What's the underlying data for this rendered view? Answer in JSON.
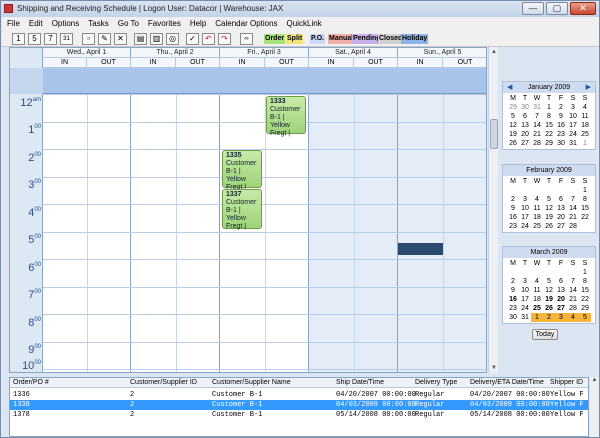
{
  "window": {
    "title": "Shipping and Receiving Schedule | Logon User: Datacor | Warehouse: JAX",
    "min": "—",
    "max": "▢",
    "close": "✕"
  },
  "menu": [
    "File",
    "Edit",
    "Options",
    "Tasks",
    "Go To",
    "Favorites",
    "Help",
    "Calendar Options",
    "QuickLink"
  ],
  "toolbar": {
    "buttons": [
      "1",
      "5",
      "7",
      "31",
      "new",
      "edit",
      "delete",
      "print",
      "preview",
      "find",
      "check",
      "undo",
      "redo",
      "link"
    ],
    "legend": [
      {
        "label": "Order",
        "color": "#a8e27a"
      },
      {
        "label": "Split",
        "color": "#f4e27a"
      },
      {
        "label": "P.O.",
        "color": "#c9d8f4"
      },
      {
        "label": "Manual",
        "color": "#f0b0a8"
      },
      {
        "label": "Pending",
        "color": "#c8b0e8"
      },
      {
        "label": "Closed",
        "color": "#d0d0d0"
      },
      {
        "label": "Holiday",
        "color": "#8ab4e8"
      }
    ]
  },
  "calendar": {
    "days": [
      {
        "label": "Wed., April 1"
      },
      {
        "label": "Thu., April 2"
      },
      {
        "label": "Fri., April 3"
      },
      {
        "label": "Sat., April 4"
      },
      {
        "label": "Sun., April 5"
      }
    ],
    "in_label": "IN",
    "out_label": "OUT",
    "hours": [
      {
        "h": "12",
        "s": "am"
      },
      {
        "h": "1",
        "s": "00"
      },
      {
        "h": "2",
        "s": "00"
      },
      {
        "h": "3",
        "s": "00"
      },
      {
        "h": "4",
        "s": "00"
      },
      {
        "h": "5",
        "s": "00"
      },
      {
        "h": "6",
        "s": "00"
      },
      {
        "h": "7",
        "s": "00"
      },
      {
        "h": "8",
        "s": "00"
      },
      {
        "h": "9",
        "s": "00"
      },
      {
        "h": "10",
        "s": "00"
      }
    ],
    "appointments": [
      {
        "num": "1333",
        "l1": "Customer",
        "l2": "B-1 | Yellow",
        "l3": "Fregt |"
      },
      {
        "num": "1335",
        "l1": "Customer",
        "l2": "B-1 | Yellow",
        "l3": "Fregt |"
      },
      {
        "num": "1337",
        "l1": "Customer",
        "l2": "B-1 | Yellow",
        "l3": "Fregt |"
      }
    ]
  },
  "minicals": [
    {
      "title": "January 2009",
      "prev": "◀",
      "next": "▶",
      "dow": [
        "M",
        "T",
        "W",
        "T",
        "F",
        "S",
        "S"
      ],
      "cells": [
        "29",
        "30",
        "31",
        "1",
        "2",
        "3",
        "4",
        "5",
        "6",
        "7",
        "8",
        "9",
        "10",
        "11",
        "12",
        "13",
        "14",
        "15",
        "16",
        "17",
        "18",
        "19",
        "20",
        "21",
        "22",
        "23",
        "24",
        "25",
        "26",
        "27",
        "28",
        "29",
        "30",
        "31",
        "1"
      ]
    },
    {
      "title": "February 2009",
      "dow": [
        "M",
        "T",
        "W",
        "T",
        "F",
        "S",
        "S"
      ],
      "cells": [
        "",
        "",
        "",
        "",
        "",
        "",
        "1",
        "2",
        "3",
        "4",
        "5",
        "6",
        "7",
        "8",
        "9",
        "10",
        "11",
        "12",
        "13",
        "14",
        "15",
        "16",
        "17",
        "18",
        "19",
        "20",
        "21",
        "22",
        "23",
        "24",
        "25",
        "26",
        "27",
        "28",
        ""
      ]
    },
    {
      "title": "March 2009",
      "dow": [
        "M",
        "T",
        "W",
        "T",
        "F",
        "S",
        "S"
      ],
      "cells": [
        "",
        "",
        "",
        "",
        "",
        "",
        "1",
        "2",
        "3",
        "4",
        "5",
        "6",
        "7",
        "8",
        "9",
        "10",
        "11",
        "12",
        "13",
        "14",
        "15",
        "16",
        "17",
        "18",
        "19",
        "20",
        "21",
        "22",
        "23",
        "24",
        "25",
        "26",
        "27",
        "28",
        "29",
        "30",
        "31",
        "1",
        "2",
        "3",
        "4",
        "5"
      ]
    }
  ],
  "today_label": "Today",
  "list": {
    "headers": [
      "Order/PO #",
      "Customer/Supplier ID",
      "Customer/Supplier Name",
      "Ship Date/Time",
      "Delivery Type",
      "Delivery/ETA Date/Time",
      "Shipper ID"
    ],
    "rows": [
      [
        "1336",
        "2",
        "Customer B-1",
        "04/20/2007 00:00:00",
        "Regular",
        "04/20/2007 00:00:00",
        "Yellow F"
      ],
      [
        "1338",
        "2",
        "Customer B-1",
        "04/03/2009 00:00:00",
        "Regular",
        "04/03/2009 00:00:00",
        "Yellow F"
      ],
      [
        "1378",
        "2",
        "Customer B-1",
        "05/14/2008 00:00:00",
        "Regular",
        "05/14/2008 00:00:00",
        "Yellow F"
      ]
    ]
  }
}
